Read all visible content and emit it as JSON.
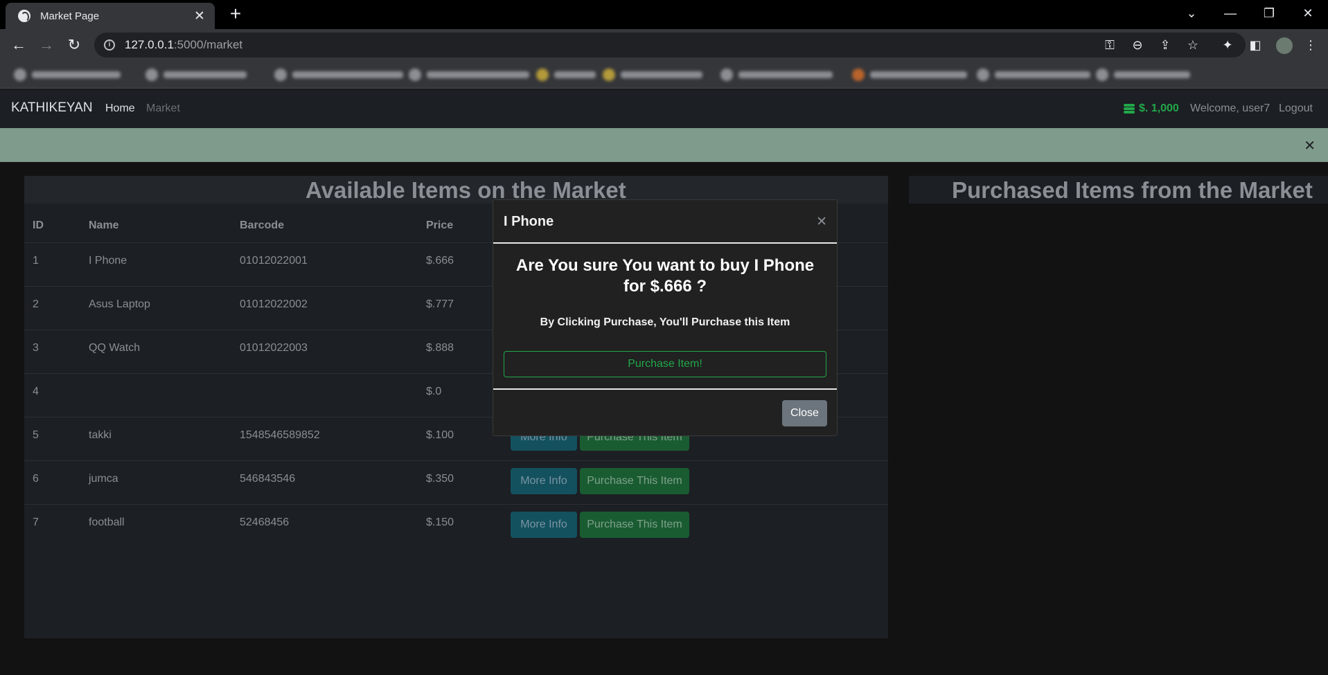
{
  "browser": {
    "tab_title": "Market Page",
    "url_host": "127.0.0.1",
    "url_path": ":5000/market"
  },
  "navbar": {
    "brand": "KATHIKEYAN",
    "links": [
      "Home",
      "Market"
    ],
    "budget": "$. 1,000",
    "welcome": "Welcome, user7",
    "logout": "Logout"
  },
  "market": {
    "heading": "Available Items on the Market",
    "columns": [
      "ID",
      "Name",
      "Barcode",
      "Price"
    ],
    "rows": [
      {
        "id": "1",
        "name": "I Phone",
        "barcode": "01012022001",
        "price": "$.666"
      },
      {
        "id": "2",
        "name": "Asus Laptop",
        "barcode": "01012022002",
        "price": "$.777"
      },
      {
        "id": "3",
        "name": "QQ Watch",
        "barcode": "01012022003",
        "price": "$.888"
      },
      {
        "id": "4",
        "name": "",
        "barcode": "",
        "price": "$.0"
      },
      {
        "id": "5",
        "name": "takki",
        "barcode": "1548546589852",
        "price": "$.100"
      },
      {
        "id": "6",
        "name": "jumca",
        "barcode": "546843546",
        "price": "$.350"
      },
      {
        "id": "7",
        "name": "football",
        "barcode": "52468456",
        "price": "$.150"
      }
    ],
    "more_info_label": "More Info",
    "purchase_label": "Purchase This Item"
  },
  "purchased": {
    "heading": "Purchased Items from the Market"
  },
  "modal": {
    "title": "I Phone",
    "question": "Are You sure You want to buy I Phone for $.666 ?",
    "note": "By Clicking Purchase, You'll Purchase this Item",
    "purchase_button": "Purchase Item!",
    "close_button": "Close"
  }
}
